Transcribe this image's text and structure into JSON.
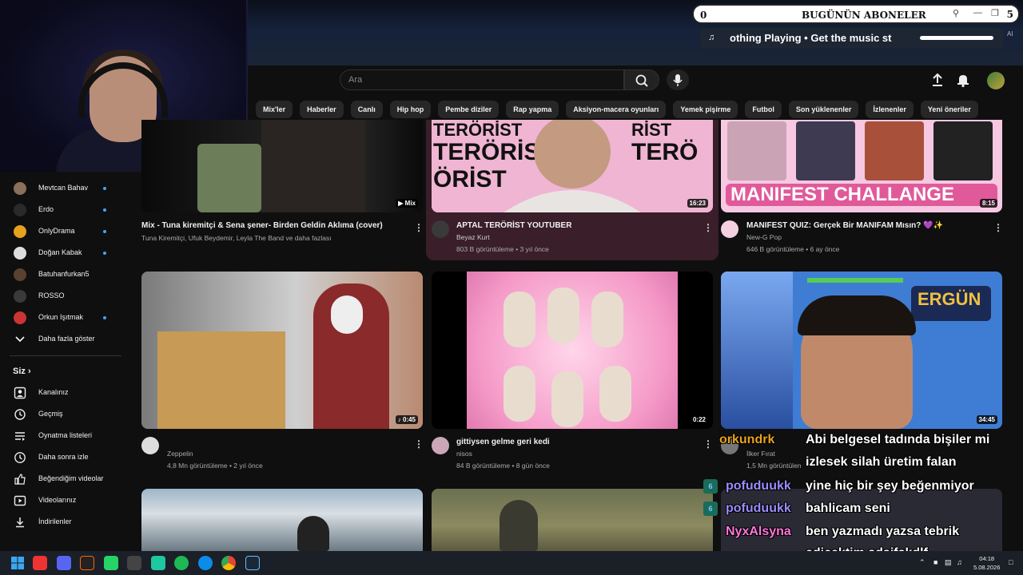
{
  "overlay": {
    "sub_counter_left": "0",
    "sub_title": "BUGÜNÜN ABONELER",
    "sub_counter_right": "5",
    "music_text": "othing Playing  •  Get the music st",
    "ai_tag": "AI"
  },
  "header": {
    "search_placeholder": "Ara"
  },
  "chips": [
    "Mix'ler",
    "Haberler",
    "Canlı",
    "Hip hop",
    "Pembe diziler",
    "Rap yapma",
    "Aksiyon-macera oyunları",
    "Yemek pişirme",
    "Futbol",
    "Son yüklenenler",
    "İzlenenler",
    "Yeni öneriler"
  ],
  "sidebar": {
    "subscriptions": [
      {
        "name": "Mevtcan Bahav",
        "live": true
      },
      {
        "name": "Erdo",
        "live": true
      },
      {
        "name": "OnlyDrama",
        "live": true
      },
      {
        "name": "Doğan Kabak",
        "live": true
      },
      {
        "name": "Batuhanfurkan5",
        "live": false
      },
      {
        "name": "ROSSO",
        "live": false
      },
      {
        "name": "Orkun Işıtmak",
        "live": true
      }
    ],
    "show_more": "Daha fazla göster",
    "you_heading": "Siz",
    "you_items": [
      "Kanalınız",
      "Geçmiş",
      "Oynatma listeleri",
      "Daha sonra izle",
      "Beğendiğim videolar",
      "Videolarınız",
      "İndirilenler"
    ]
  },
  "videos": {
    "v1": {
      "title": "Mix - Tuna kiremitçi & Sena şener- Birden Geldin Aklıma (cover)",
      "meta": "Tuna Kiremitçi, Ufuk Beydemir, Leyla The Band ve daha fazlası",
      "badge": "▶ Mix"
    },
    "v2": {
      "title": "APTAL TERÖRİST YOUTUBER",
      "channel": "Beyaz Kurt",
      "meta": "803 B görüntüleme • 3 yıl önce",
      "duration": "16:23",
      "thumb_text": "TERÖRİST"
    },
    "v3": {
      "title": "MANIFEST QUIZ: Gerçek Bir MANIFAM Mısın? 💜✨",
      "channel": "New-G Pop",
      "meta": "646 B görüntüleme • 6 ay önce",
      "duration": "8:15",
      "thumb_text": "MANIFEST CHALLANGE"
    },
    "v4": {
      "title": "",
      "channel": "Zeppelin",
      "meta": "4,8 Mn görüntüleme • 2 yıl önce",
      "duration": "♪ 0:45"
    },
    "v5": {
      "title": "gittiysen gelme geri kedi",
      "channel": "nisos",
      "meta": "84 B görüntüleme • 8 gün önce",
      "duration": "0:22"
    },
    "v6": {
      "title": "",
      "channel": "İlker Fırat",
      "meta": "1,5 Mn görüntülen",
      "duration": "34:45",
      "thumb_text": "ERGÜN"
    }
  },
  "chat": [
    {
      "user": "orkundrk",
      "msg": "Abi belgesel tadında bişiler mi",
      "color": "#e8a31e"
    },
    {
      "user": "",
      "msg": "izlesek silah üretim falan",
      "color": "#ffffff"
    },
    {
      "user": "pofuduukk",
      "msg": "yine hiç bir şey beğenmiyor",
      "color": "#9b8cff"
    },
    {
      "user": "pofuduukk",
      "msg": "bahlicam seni",
      "color": "#9b8cff"
    },
    {
      "user": "NyxAlsyna",
      "msg": "ben yazmadı yazsa tebrik",
      "color": "#ff77d9"
    },
    {
      "user": "",
      "msg": "edicektim sdşifskdlf",
      "color": "#ffffff"
    }
  ],
  "taskbar": {
    "time": "04:18",
    "date": "5.08.2026"
  }
}
